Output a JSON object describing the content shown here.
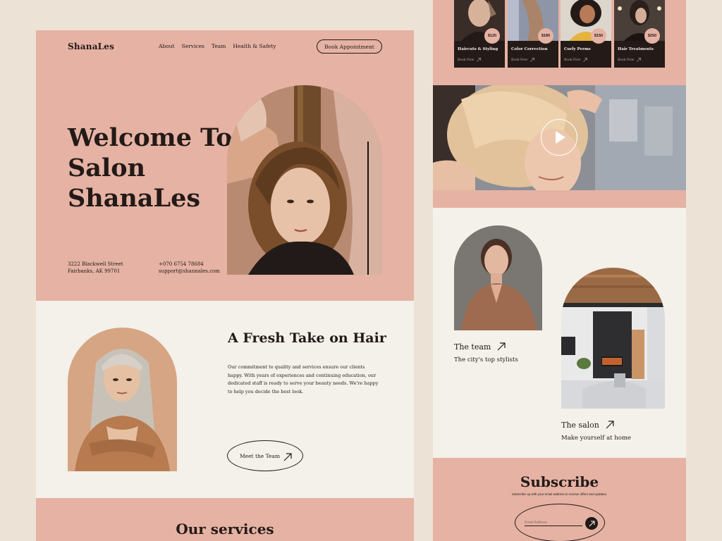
{
  "brand": "ShanaLes",
  "nav": [
    "About",
    "Services",
    "Team",
    "Health & Safety"
  ],
  "book_button": "Book Appointment",
  "hero": {
    "title_line1": "Welcome To",
    "title_line2": "Salon ShanaLes",
    "address_line1": "3222 Blackwell Street",
    "address_line2": "Fairbanks, AK 99701",
    "phone": "+070 6754 78684",
    "email": "support@shannales.com"
  },
  "about": {
    "title": "A Fresh Take on Hair",
    "text": "Our commitment to quality and services ensure our clients happy. With years of experiences and continuing education, our dedicated staff is ready to serve your beauty needs. We're happy to help you decide the best look.",
    "button": "Meet the Team"
  },
  "services_title": "Our services",
  "service_cards": [
    {
      "name": "Haircuts & Styling",
      "price": "$120",
      "cta": "Book Now"
    },
    {
      "name": "Color Correction",
      "price": "$180",
      "cta": "Book Now"
    },
    {
      "name": "Curly Perms",
      "price": "$150",
      "cta": "Book Now"
    },
    {
      "name": "Hair Treatments",
      "price": "$250",
      "cta": "Book Now"
    }
  ],
  "team": {
    "label": "The team",
    "sub": "The city's top stylists"
  },
  "salon": {
    "label": "The salon",
    "sub": "Make yourself at home"
  },
  "subscribe": {
    "title": "Subscribe",
    "text": "Subscribe up with your email address to receive offers and updates.",
    "placeholder": "Email Address"
  },
  "colors": {
    "pink": "#e5b2a4",
    "cream": "#f4f0ea",
    "dark": "#231a17",
    "background": "#ece3d6"
  }
}
